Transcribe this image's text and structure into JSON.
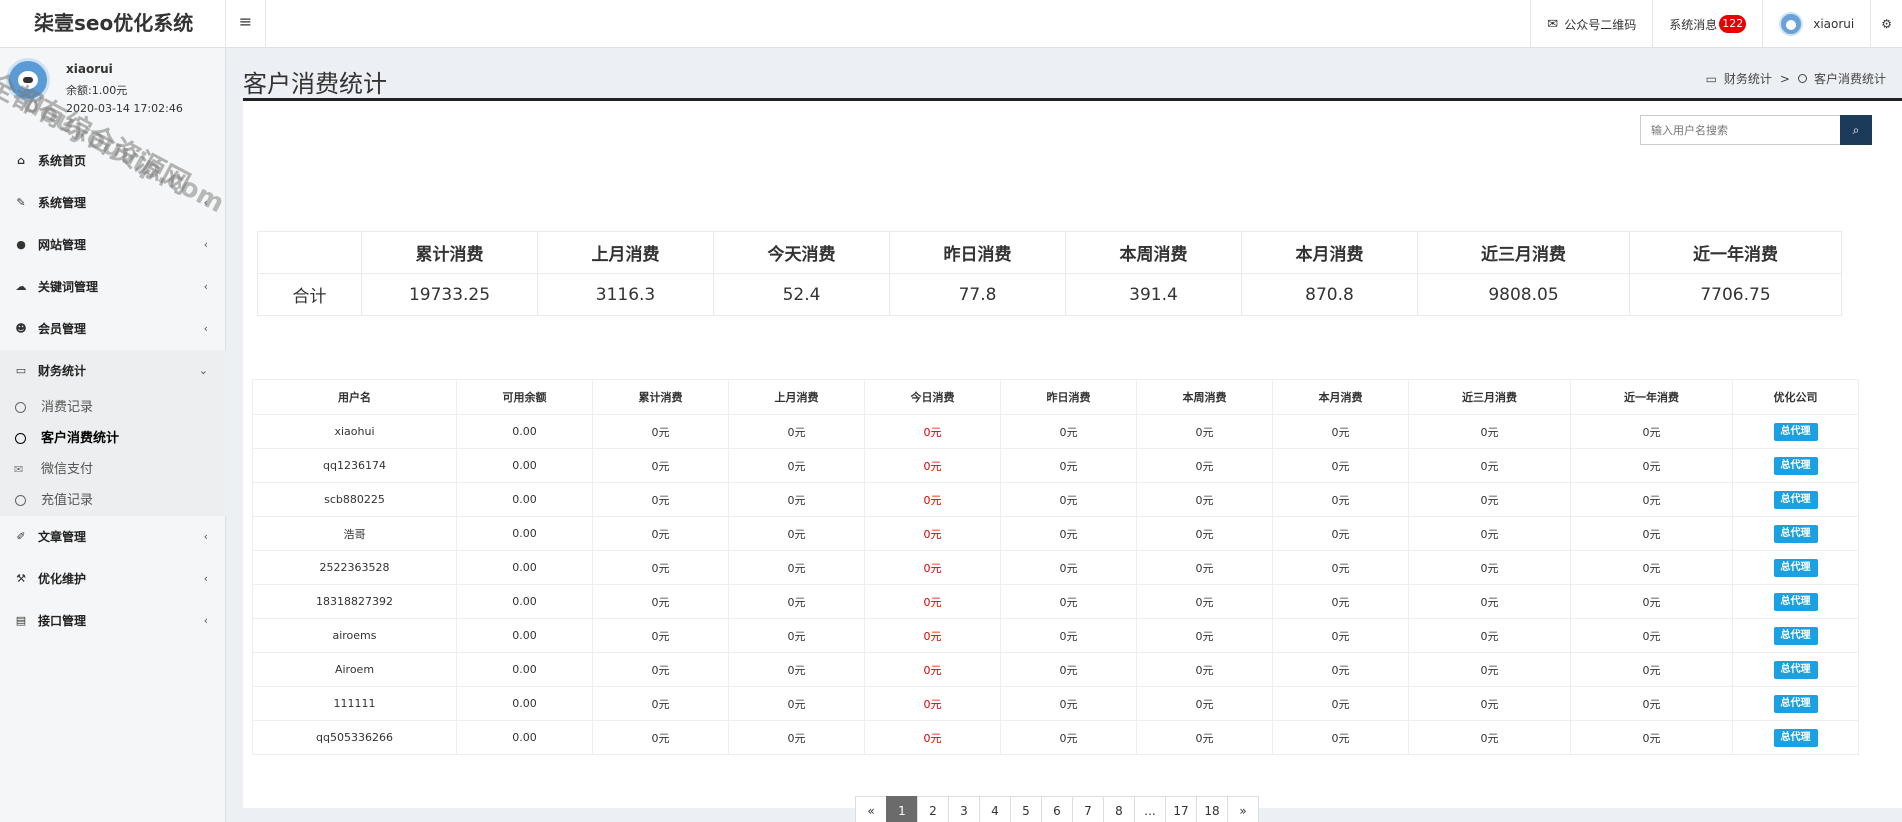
{
  "app": {
    "title": "柒壹seo优化系统"
  },
  "topbar": {
    "menu_toggle": "≡",
    "wechat_qr": "公众号二维码",
    "messages_label": "系统消息",
    "messages_count": "122",
    "username": "xiaorui",
    "settings_icon": "gears-icon"
  },
  "user_panel": {
    "name": "xiaorui",
    "balance": "余额:1.00元",
    "datetime": "2020-03-14 17:02:46"
  },
  "sidebar": {
    "items": [
      {
        "label": "系统首页",
        "icon": "home-icon",
        "has_caret": false
      },
      {
        "label": "系统管理",
        "icon": "wrench-icon",
        "has_caret": true
      },
      {
        "label": "网站管理",
        "icon": "circle-icon",
        "has_caret": true
      },
      {
        "label": "关键词管理",
        "icon": "cloud-icon",
        "has_caret": true
      },
      {
        "label": "会员管理",
        "icon": "users-icon",
        "has_caret": true
      },
      {
        "label": "财务统计",
        "icon": "card-icon",
        "has_caret": true,
        "open": true
      },
      {
        "label": "文章管理",
        "icon": "edit-icon",
        "has_caret": true
      },
      {
        "label": "优化维护",
        "icon": "hammer-icon",
        "has_caret": true
      },
      {
        "label": "接口管理",
        "icon": "book-icon",
        "has_caret": true
      }
    ],
    "finance_sub": [
      {
        "label": "消费记录",
        "icon": "circle-icon",
        "active": false
      },
      {
        "label": "客户消费统计",
        "icon": "circle-icon",
        "active": true
      },
      {
        "label": "微信支付",
        "icon": "wechat-icon",
        "active": false
      },
      {
        "label": "充值记录",
        "icon": "circle-icon",
        "active": false
      }
    ]
  },
  "page": {
    "title": "客户消费统计",
    "breadcrumb": {
      "parent": "财务统计",
      "separator": ">",
      "current": "客户消费统计"
    }
  },
  "search": {
    "placeholder": "输入用户名搜索"
  },
  "summary": {
    "headers": [
      "",
      "累计消费",
      "上月消费",
      "今天消费",
      "昨日消费",
      "本周消费",
      "本月消费",
      "近三月消费",
      "近一年消费"
    ],
    "row": [
      "合计",
      "19733.25",
      "3116.3",
      "52.4",
      "77.8",
      "391.4",
      "870.8",
      "9808.05",
      "7706.75"
    ]
  },
  "table": {
    "headers": [
      "用户名",
      "可用余额",
      "累计消费",
      "上月消费",
      "今日消费",
      "昨日消费",
      "本周消费",
      "本月消费",
      "近三月消费",
      "近一年消费",
      "优化公司"
    ],
    "rows": [
      [
        "xiaohui",
        "0.00",
        "0元",
        "0元",
        "0元",
        "0元",
        "0元",
        "0元",
        "0元",
        "0元",
        "总代理"
      ],
      [
        "qq1236174",
        "0.00",
        "0元",
        "0元",
        "0元",
        "0元",
        "0元",
        "0元",
        "0元",
        "0元",
        "总代理"
      ],
      [
        "scb880225",
        "0.00",
        "0元",
        "0元",
        "0元",
        "0元",
        "0元",
        "0元",
        "0元",
        "0元",
        "总代理"
      ],
      [
        "浩哥",
        "0.00",
        "0元",
        "0元",
        "0元",
        "0元",
        "0元",
        "0元",
        "0元",
        "0元",
        "总代理"
      ],
      [
        "2522363528",
        "0.00",
        "0元",
        "0元",
        "0元",
        "0元",
        "0元",
        "0元",
        "0元",
        "0元",
        "总代理"
      ],
      [
        "18318827392",
        "0.00",
        "0元",
        "0元",
        "0元",
        "0元",
        "0元",
        "0元",
        "0元",
        "0元",
        "总代理"
      ],
      [
        "airoems",
        "0.00",
        "0元",
        "0元",
        "0元",
        "0元",
        "0元",
        "0元",
        "0元",
        "0元",
        "总代理"
      ],
      [
        "Airoem",
        "0.00",
        "0元",
        "0元",
        "0元",
        "0元",
        "0元",
        "0元",
        "0元",
        "0元",
        "总代理"
      ],
      [
        "111111",
        "0.00",
        "0元",
        "0元",
        "0元",
        "0元",
        "0元",
        "0元",
        "0元",
        "0元",
        "总代理"
      ],
      [
        "qq505336266",
        "0.00",
        "0元",
        "0元",
        "0元",
        "0元",
        "0元",
        "0元",
        "0元",
        "0元",
        "总代理"
      ]
    ]
  },
  "pagination": [
    "«",
    "1",
    "2",
    "3",
    "4",
    "5",
    "6",
    "7",
    "8",
    "...",
    "17",
    "18",
    "»"
  ],
  "pagination_active": "1",
  "watermark": {
    "line1": "全都有综合资源网",
    "line2": "douyouvip.com"
  }
}
